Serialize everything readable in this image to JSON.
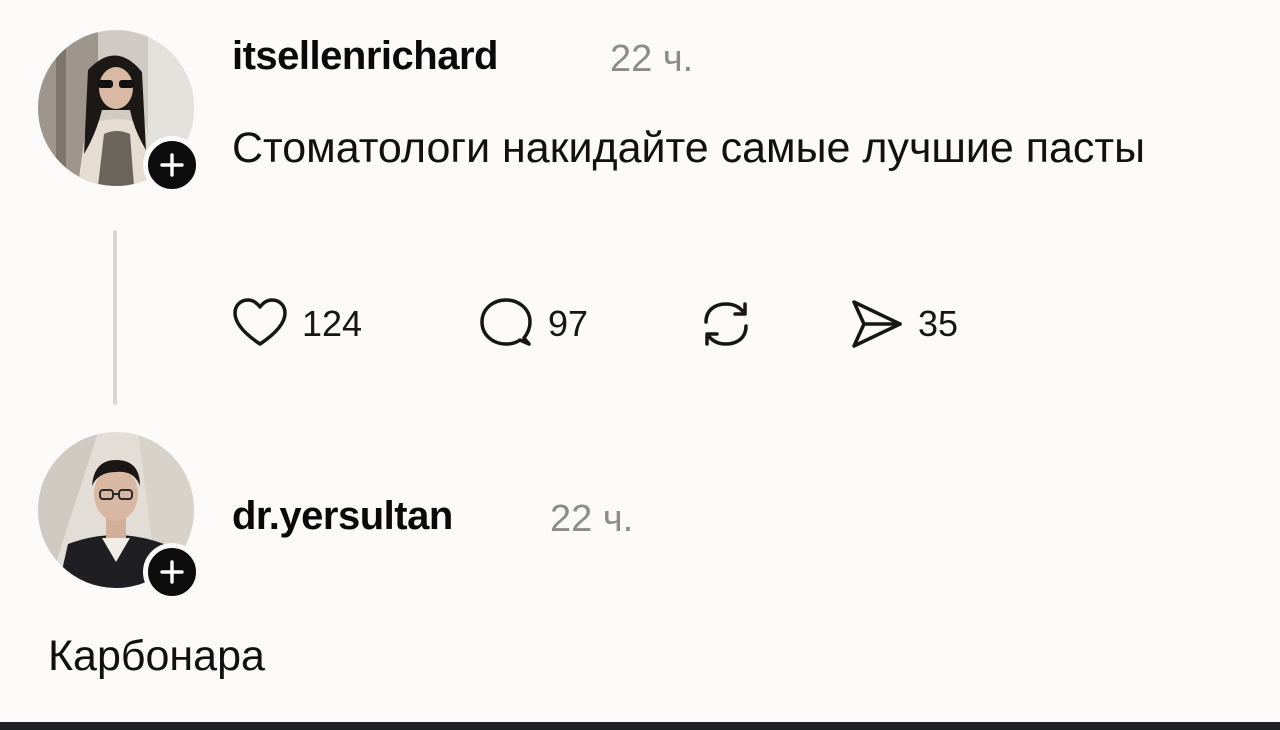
{
  "posts": [
    {
      "username": "itsellenrichard",
      "time": "22 ч.",
      "text": "Стоматологи накидайте самые лучшие пасты",
      "likes": "124",
      "comments": "97",
      "shares": "35",
      "avatar_icon": "avatar-woman-photo",
      "follow_icon": "plus-icon"
    },
    {
      "username": "dr.yersultan",
      "time": "22 ч.",
      "avatar_icon": "avatar-man-photo",
      "follow_icon": "plus-icon"
    }
  ],
  "reply": {
    "text": "Карбонара"
  },
  "colors": {
    "background": "#fbfaf8",
    "text": "#111111",
    "muted": "#8c8c8c",
    "thread_line": "#d6d6d6",
    "badge": "#0d0d0d"
  }
}
